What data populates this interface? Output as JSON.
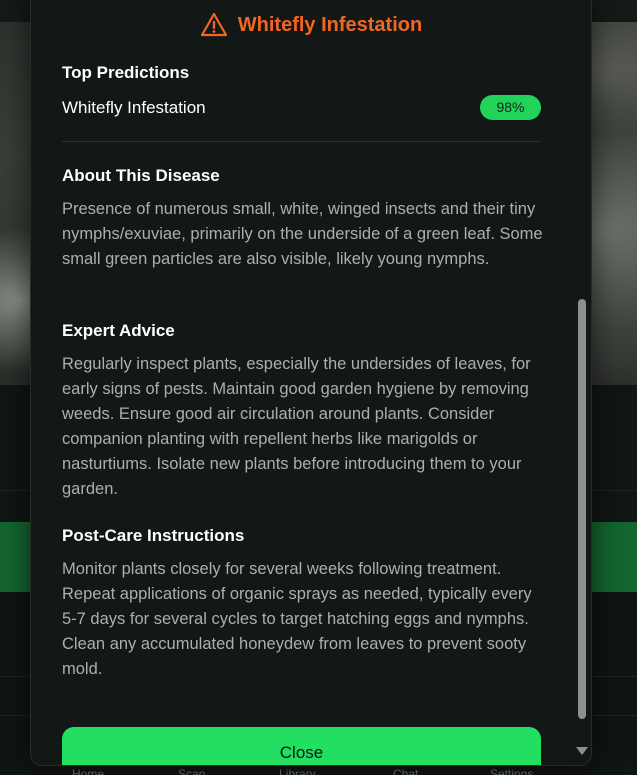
{
  "modal": {
    "title": "Whitefly Infestation",
    "title_icon": "warning-triangle-icon",
    "accent_color": "#f26522"
  },
  "predictions": {
    "heading": "Top Predictions",
    "items": [
      {
        "name": "Whitefly Infestation",
        "confidence": "98%"
      }
    ],
    "badge_color": "#22d35b"
  },
  "about": {
    "heading": "About This Disease",
    "text": "Presence of numerous small, white, winged insects and their tiny nymphs/exuviae, primarily on the underside of a green leaf. Some small green particles are also visible, likely young nymphs."
  },
  "advice": {
    "heading": "Expert Advice",
    "text": "Regularly inspect plants, especially the undersides of leaves, for early signs of pests. Maintain good garden hygiene by removing weeds. Ensure good air circulation around plants. Consider companion planting with repellent herbs like marigolds or nasturtiums. Isolate new plants before introducing them to your garden."
  },
  "post_care": {
    "heading": "Post-Care Instructions",
    "text": "Monitor plants closely for several weeks following treatment. Repeat applications of organic sprays as needed, typically every 5-7 days for several cycles to target hatching eggs and nymphs. Clean any accumulated honeydew from leaves to prevent sooty mold."
  },
  "close_button": {
    "label": "Close",
    "color": "#22df62"
  },
  "bottom_nav": {
    "items": [
      "Home",
      "Scan",
      "Library",
      "Chat",
      "Settings"
    ]
  }
}
